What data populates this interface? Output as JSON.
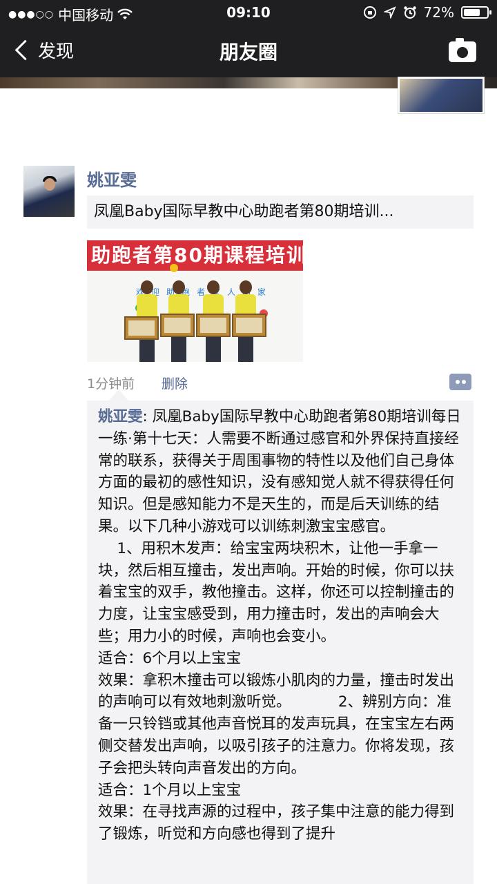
{
  "status_bar": {
    "signal_dots": "●●●○○",
    "carrier": "中国移动",
    "wifi": "wifi-icon",
    "time": "09:10",
    "battery_percent": "72%",
    "battery_level": 0.72
  },
  "nav": {
    "back_label": "发现",
    "title": "朋友圈",
    "camera_icon": "camera-icon"
  },
  "post": {
    "author": "姚亚雯",
    "link_title": "凤凰Baby国际早教中心助跑者第80期培训...",
    "photo": {
      "banner_text": "助跑者第80期课程培训",
      "welcome_text": "欢迎助跑者家人回家"
    },
    "timestamp": "1分钟前",
    "delete_label": "删除"
  },
  "comment": {
    "author": "姚亚雯",
    "text": ": 凤凰Baby国际早教中心助跑者第80期培训每日一练·第十七天：人需要不断通过感官和外界保持直接经常的联系，获得关于周围事物的特性以及他们自己身体方面的最初的感性知识，没有感知觉人就不得获得任何知识。但是感知能力不是天生的，而是后天训练的结果。以下几种小游戏可以训练刺激宝宝感官。\n    1、用积木发声：给宝宝两块积木，让他一手拿一块，然后相互撞击，发出声响。开始的时候，你可以扶着宝宝的双手，教他撞击。这样，你还可以控制撞击的力度，让宝宝感受到，用力撞击时，发出的声响会大些；用力小的时候，声响也会变小。\n适合：6个月以上宝宝\n效果：拿积木撞击可以锻炼小肌肉的力量，撞击时发出的声响可以有效地刺激听觉。          2、辨别方向：准备一只铃铛或其他声音悦耳的发声玩具，在宝宝左右两侧交替发出声响，以吸引孩子的注意力。你将发现，孩子会把头转向声音发出的方向。\n适合：1个月以上宝宝\n效果：在寻找声源的过程中，孩子集中注意的能力得到了锻炼，听觉和方向感也得到了提升"
  },
  "colors": {
    "bar": "#1f1f21",
    "link_blue": "#576b95",
    "card_bg": "#f3f3f5",
    "meta_gray": "#8b8b8b"
  }
}
